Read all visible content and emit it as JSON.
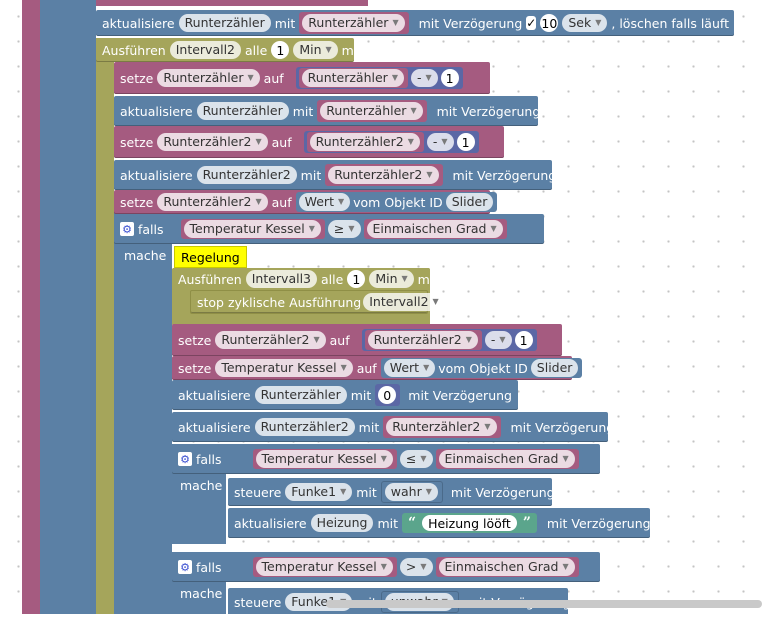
{
  "vars": {
    "runterzaehler": "Runterzähler",
    "runterzaehler2": "Runterzähler2",
    "intervall2": "Intervall2",
    "intervall3": "Intervall3",
    "temp": "Temperatur Kessel",
    "einmaisch": "Einmaischen Grad",
    "heizung": "Heizung",
    "funke1": "Funke1",
    "slider": "Slider"
  },
  "kw": {
    "aktualisiere": "aktualisiere",
    "mit": "mit",
    "mit_verz": "mit Verzögerung",
    "loeschen": ", löschen falls läuft",
    "ausfuehren": "Ausführen",
    "alle": "alle",
    "ms": "ms",
    "setze": "setze",
    "auf": "auf",
    "wert": "Wert",
    "vom_objekt": "vom Objekt ID",
    "falls": "falls",
    "mache": "mache",
    "stop": "stop zyklische Ausführung",
    "steuere": "steuere",
    "sek": "Sek",
    "min": "Min",
    "minus": "-",
    "gte": "≥",
    "lte": "≤",
    "gt": ">"
  },
  "nums": {
    "delay10": "10",
    "one": "1",
    "zero": "0"
  },
  "tooltip": "Regelung",
  "strings": {
    "heizung_loeoft": "Heizung lööft",
    "wahr": "wahr",
    "unwahr": "unwahr"
  },
  "icons": {
    "check": "✓",
    "gear": "⚙",
    "arrow": "▼"
  }
}
